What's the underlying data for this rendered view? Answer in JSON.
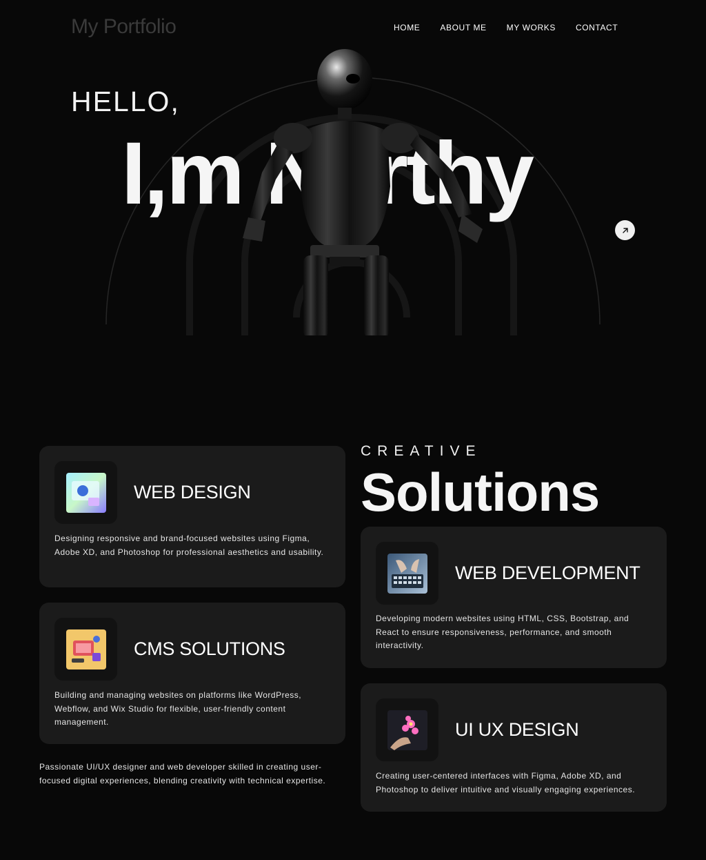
{
  "nav": {
    "logo": "My Portfolio",
    "items": [
      "HOME",
      "ABOUT ME",
      "MY WORKS",
      "CONTACT"
    ]
  },
  "hero": {
    "greeting": "HELLO,",
    "name": "I,m Nerthy",
    "arrow_icon": "arrow-up-right-icon"
  },
  "services": {
    "eyebrow": "CREATIVE",
    "heading": "Solutions",
    "intro": "Passionate UI/UX designer and web developer skilled in creating user-focused digital experiences, blending creativity with technical expertise.",
    "cards": [
      {
        "title": "WEB DESIGN",
        "desc": "Designing responsive and brand-focused websites using Figma, Adobe XD, and Photoshop for professional aesthetics and usability.",
        "icon": "web-design-thumbnail"
      },
      {
        "title": "CMS SOLUTIONS",
        "desc": "Building and managing websites on platforms like WordPress, Webflow, and Wix Studio for flexible, user-friendly content management.",
        "icon": "cms-thumbnail"
      },
      {
        "title": "WEB DEVELOPMENT",
        "desc": "Developing modern websites using HTML, CSS, Bootstrap, and React to ensure responsiveness, performance, and smooth interactivity.",
        "icon": "keyboard-thumbnail"
      },
      {
        "title": "UI UX DESIGN",
        "desc": "Creating user-centered interfaces with Figma, Adobe XD, and Photoshop to deliver intuitive and visually engaging experiences.",
        "icon": "flower-hand-thumbnail"
      }
    ]
  }
}
